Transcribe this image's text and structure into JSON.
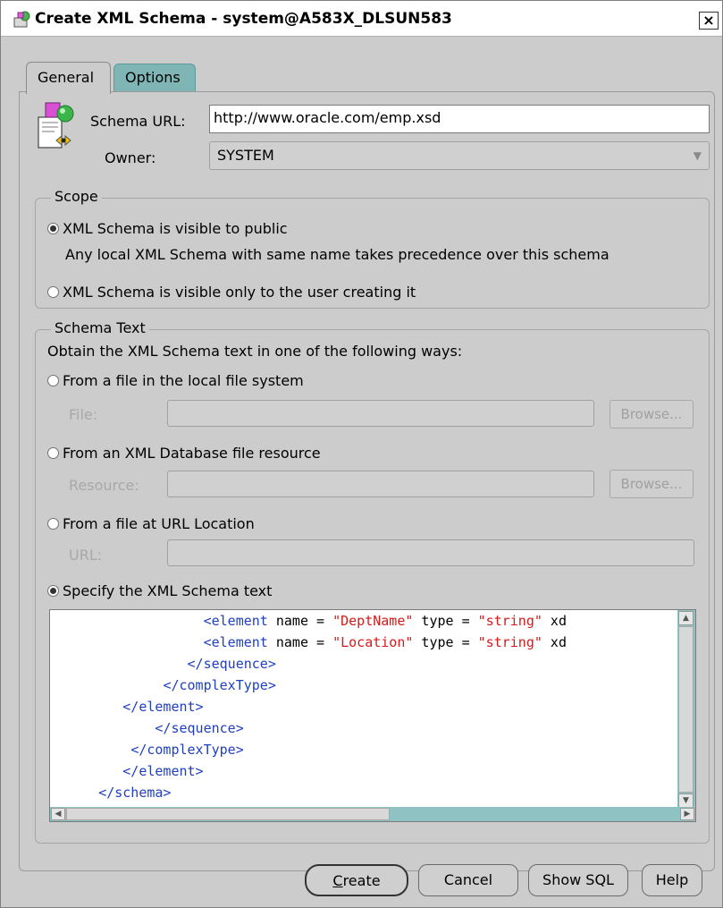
{
  "window": {
    "title": "Create XML Schema - system@A583X_DLSUN583",
    "close_glyph": "×"
  },
  "tabs": [
    {
      "label": "General",
      "selected": true
    },
    {
      "label": "Options",
      "selected": false
    }
  ],
  "general": {
    "schema_url_label": "Schema URL:",
    "schema_url_value": "http://www.oracle.com/emp.xsd",
    "owner_label": "Owner:",
    "owner_value": "SYSTEM",
    "owner_arrow": "▼"
  },
  "scope": {
    "title": "Scope",
    "public_label": "XML Schema is visible to public",
    "public_selected": true,
    "public_note": "Any local XML Schema with same name takes precedence over this schema",
    "private_label": "XML Schema is visible only to the user creating it",
    "private_selected": false
  },
  "schema_text": {
    "title": "Schema Text",
    "intro": "Obtain the XML Schema text in one of the following ways:",
    "option_local_file": "From a file in the local file system",
    "file_label": "File:",
    "file_value": "",
    "browse_file_label": "Browse...",
    "option_db_resource": "From an XML Database file resource",
    "resource_label": "Resource:",
    "resource_value": "",
    "browse_resource_label": "Browse...",
    "option_url": "From a file at URL Location",
    "url_label": "URL:",
    "url_value": "",
    "option_specify": "Specify the XML Schema text",
    "selected_option": "specify"
  },
  "editor": {
    "lines": [
      {
        "indent": "                   ",
        "t1": "<element",
        "p1": " name = ",
        "s1": "\"DeptName\"",
        "p2": " type = ",
        "s2": "\"string\"",
        "p3": " xd"
      },
      {
        "indent": "                   ",
        "t1": "<element",
        "p1": " name = ",
        "s1": "\"Location\"",
        "p2": " type = ",
        "s2": "\"string\"",
        "p3": " xd"
      },
      {
        "indent": "                 ",
        "t1": "</sequence>",
        "p1": "",
        "s1": "",
        "p2": "",
        "s2": "",
        "p3": ""
      },
      {
        "indent": "              ",
        "t1": "</complexType>",
        "p1": "",
        "s1": "",
        "p2": "",
        "s2": "",
        "p3": ""
      },
      {
        "indent": "         ",
        "t1": "</element>",
        "p1": "",
        "s1": "",
        "p2": "",
        "s2": "",
        "p3": ""
      },
      {
        "indent": "             ",
        "t1": "</sequence>",
        "p1": "",
        "s1": "",
        "p2": "",
        "s2": "",
        "p3": ""
      },
      {
        "indent": "          ",
        "t1": "</complexType>",
        "p1": "",
        "s1": "",
        "p2": "",
        "s2": "",
        "p3": ""
      },
      {
        "indent": "         ",
        "t1": "</element>",
        "p1": "",
        "s1": "",
        "p2": "",
        "s2": "",
        "p3": ""
      },
      {
        "indent": "      ",
        "t1": "</schema>",
        "p1": "",
        "s1": "",
        "p2": "",
        "s2": "",
        "p3": ""
      }
    ],
    "scroll_up": "▲",
    "scroll_down": "▼",
    "scroll_left": "◀",
    "scroll_right": "▶"
  },
  "buttons": {
    "create_mnemonic": "C",
    "create_rest": "reate",
    "cancel": "Cancel",
    "show_sql": "Show SQL",
    "help": "Help"
  },
  "colors": {
    "dialog_bg": "#cccccc",
    "tab_inactive": "#7fb5b5",
    "scrollbar": "#8fc2c2",
    "code_tag": "#1f3fbf",
    "code_string": "#d61a1a"
  },
  "icons": {
    "title": "xml-schema-app-icon",
    "header": "xml-schema-document-icon"
  }
}
